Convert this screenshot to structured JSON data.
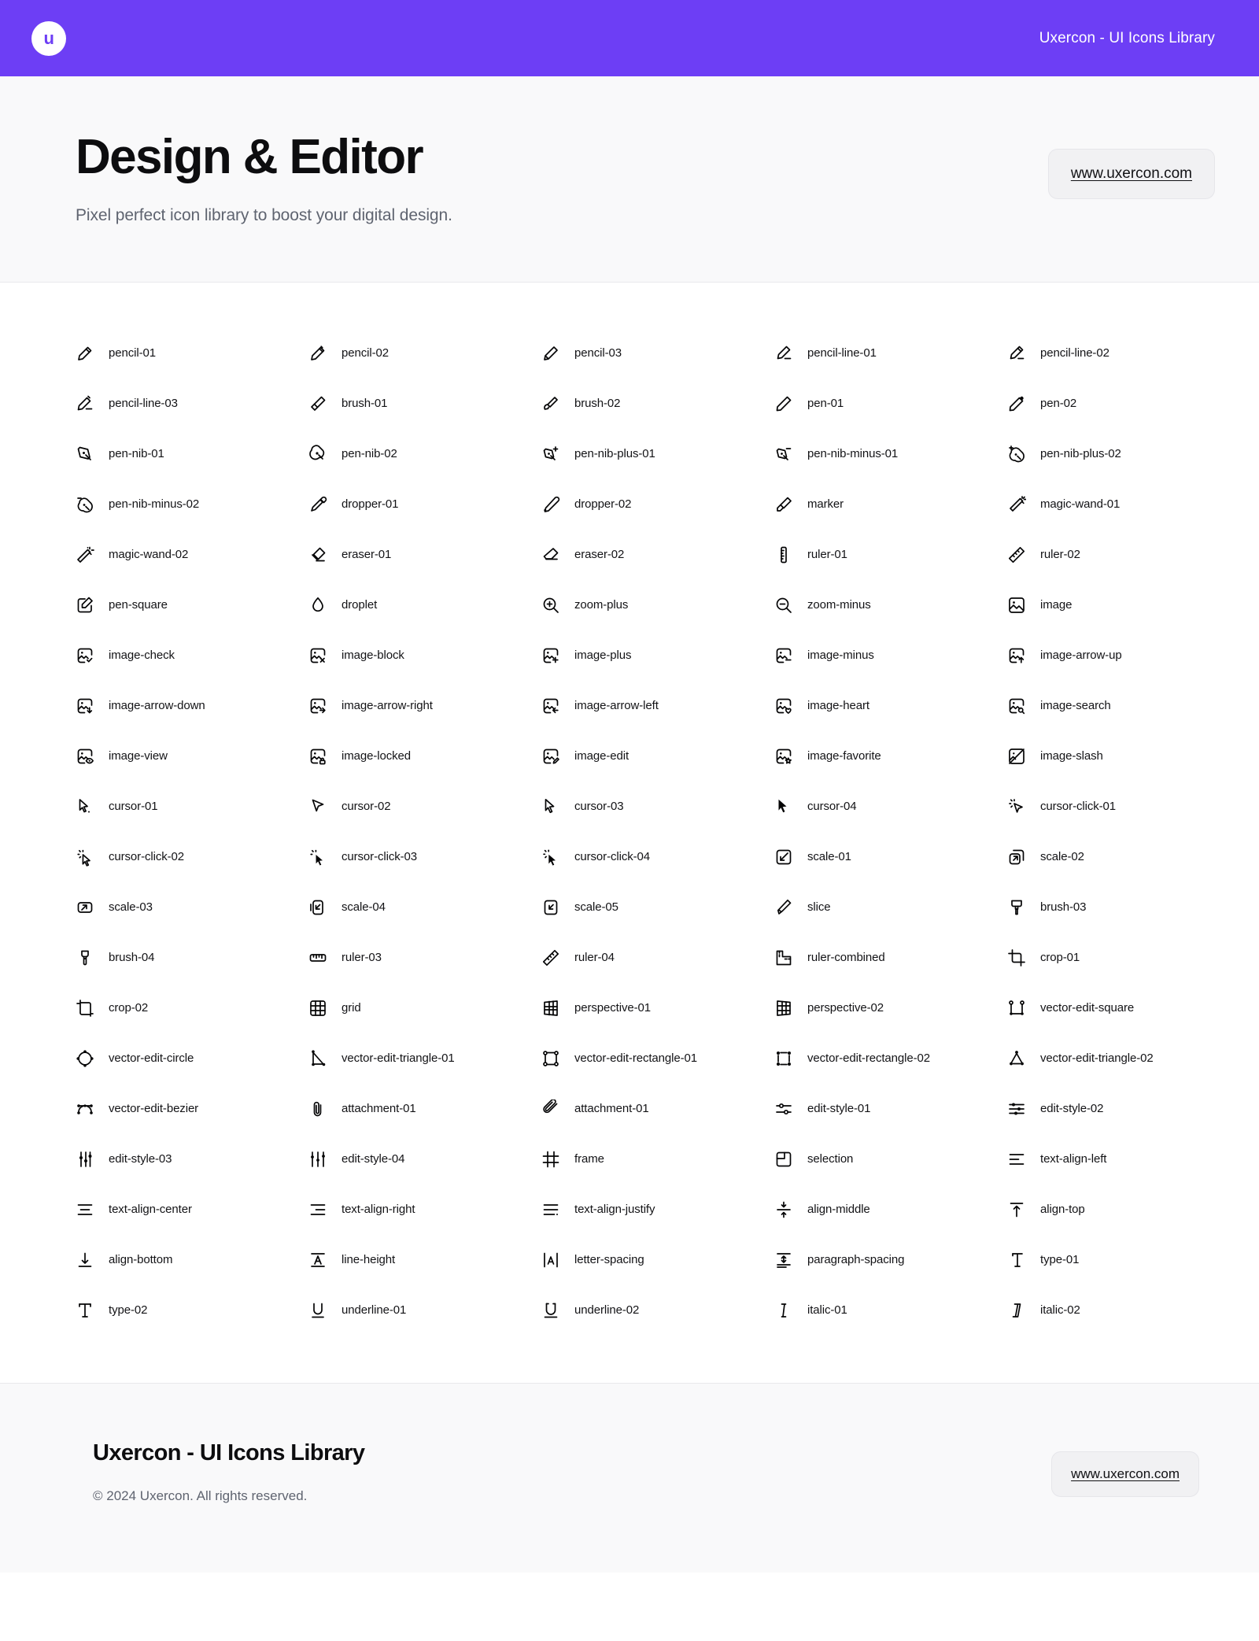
{
  "topbar": {
    "logo_glyph": "u",
    "logo_icon": "uxercon-logo-icon",
    "title": "Uxercon - UI Icons Library",
    "background_color": "#6d3ef5"
  },
  "hero": {
    "title": "Design & Editor",
    "subtitle": "Pixel perfect icon library to boost your digital design.",
    "url_label": "www.uxercon.com"
  },
  "grid": {
    "columns": 5,
    "rows": 20,
    "count": 100,
    "icons": [
      {
        "name": "pencil-01",
        "icon": "pencil-01-icon"
      },
      {
        "name": "pencil-02",
        "icon": "pencil-02-icon"
      },
      {
        "name": "pencil-03",
        "icon": "pencil-03-icon"
      },
      {
        "name": "pencil-line-01",
        "icon": "pencil-line-01-icon"
      },
      {
        "name": "pencil-line-02",
        "icon": "pencil-line-02-icon"
      },
      {
        "name": "pencil-line-03",
        "icon": "pencil-line-03-icon"
      },
      {
        "name": "brush-01",
        "icon": "brush-01-icon"
      },
      {
        "name": "brush-02",
        "icon": "brush-02-icon"
      },
      {
        "name": "pen-01",
        "icon": "pen-01-icon"
      },
      {
        "name": "pen-02",
        "icon": "pen-02-icon"
      },
      {
        "name": "pen-nib-01",
        "icon": "pen-nib-01-icon"
      },
      {
        "name": "pen-nib-02",
        "icon": "pen-nib-02-icon"
      },
      {
        "name": "pen-nib-plus-01",
        "icon": "pen-nib-plus-01-icon"
      },
      {
        "name": "pen-nib-minus-01",
        "icon": "pen-nib-minus-01-icon"
      },
      {
        "name": "pen-nib-plus-02",
        "icon": "pen-nib-plus-02-icon"
      },
      {
        "name": "pen-nib-minus-02",
        "icon": "pen-nib-minus-02-icon"
      },
      {
        "name": "dropper-01",
        "icon": "dropper-01-icon"
      },
      {
        "name": "dropper-02",
        "icon": "dropper-02-icon"
      },
      {
        "name": "marker",
        "icon": "marker-icon"
      },
      {
        "name": "magic-wand-01",
        "icon": "magic-wand-01-icon"
      },
      {
        "name": "magic-wand-02",
        "icon": "magic-wand-02-icon"
      },
      {
        "name": "eraser-01",
        "icon": "eraser-01-icon"
      },
      {
        "name": "eraser-02",
        "icon": "eraser-02-icon"
      },
      {
        "name": "ruler-01",
        "icon": "ruler-01-icon"
      },
      {
        "name": "ruler-02",
        "icon": "ruler-02-icon"
      },
      {
        "name": "pen-square",
        "icon": "pen-square-icon"
      },
      {
        "name": "droplet",
        "icon": "droplet-icon"
      },
      {
        "name": "zoom-plus",
        "icon": "zoom-plus-icon"
      },
      {
        "name": "zoom-minus",
        "icon": "zoom-minus-icon"
      },
      {
        "name": "image",
        "icon": "image-icon"
      },
      {
        "name": "image-check",
        "icon": "image-check-icon"
      },
      {
        "name": "image-block",
        "icon": "image-block-icon"
      },
      {
        "name": "image-plus",
        "icon": "image-plus-icon"
      },
      {
        "name": "image-minus",
        "icon": "image-minus-icon"
      },
      {
        "name": "image-arrow-up",
        "icon": "image-arrow-up-icon"
      },
      {
        "name": "image-arrow-down",
        "icon": "image-arrow-down-icon"
      },
      {
        "name": "image-arrow-right",
        "icon": "image-arrow-right-icon"
      },
      {
        "name": "image-arrow-left",
        "icon": "image-arrow-left-icon"
      },
      {
        "name": "image-heart",
        "icon": "image-heart-icon"
      },
      {
        "name": "image-search",
        "icon": "image-search-icon"
      },
      {
        "name": "image-view",
        "icon": "image-view-icon"
      },
      {
        "name": "image-locked",
        "icon": "image-locked-icon"
      },
      {
        "name": "image-edit",
        "icon": "image-edit-icon"
      },
      {
        "name": "image-favorite",
        "icon": "image-favorite-icon"
      },
      {
        "name": "image-slash",
        "icon": "image-slash-icon"
      },
      {
        "name": "cursor-01",
        "icon": "cursor-01-icon"
      },
      {
        "name": "cursor-02",
        "icon": "cursor-02-icon"
      },
      {
        "name": "cursor-03",
        "icon": "cursor-03-icon"
      },
      {
        "name": "cursor-04",
        "icon": "cursor-04-icon"
      },
      {
        "name": "cursor-click-01",
        "icon": "cursor-click-01-icon"
      },
      {
        "name": "cursor-click-02",
        "icon": "cursor-click-02-icon"
      },
      {
        "name": "cursor-click-03",
        "icon": "cursor-click-03-icon"
      },
      {
        "name": "cursor-click-04",
        "icon": "cursor-click-04-icon"
      },
      {
        "name": "scale-01",
        "icon": "scale-01-icon"
      },
      {
        "name": "scale-02",
        "icon": "scale-02-icon"
      },
      {
        "name": "scale-03",
        "icon": "scale-03-icon"
      },
      {
        "name": "scale-04",
        "icon": "scale-04-icon"
      },
      {
        "name": "scale-05",
        "icon": "scale-05-icon"
      },
      {
        "name": "slice",
        "icon": "slice-icon"
      },
      {
        "name": "brush-03",
        "icon": "brush-03-icon"
      },
      {
        "name": "brush-04",
        "icon": "brush-04-icon"
      },
      {
        "name": "ruler-03",
        "icon": "ruler-03-icon"
      },
      {
        "name": "ruler-04",
        "icon": "ruler-04-icon"
      },
      {
        "name": "ruler-combined",
        "icon": "ruler-combined-icon"
      },
      {
        "name": "crop-01",
        "icon": "crop-01-icon"
      },
      {
        "name": "crop-02",
        "icon": "crop-02-icon"
      },
      {
        "name": "grid",
        "icon": "grid-icon"
      },
      {
        "name": "perspective-01",
        "icon": "perspective-01-icon"
      },
      {
        "name": "perspective-02",
        "icon": "perspective-02-icon"
      },
      {
        "name": "vector-edit-square",
        "icon": "vector-edit-square-icon"
      },
      {
        "name": "vector-edit-circle",
        "icon": "vector-edit-circle-icon"
      },
      {
        "name": "vector-edit-triangle-01",
        "icon": "vector-edit-triangle-01-icon"
      },
      {
        "name": "vector-edit-rectangle-01",
        "icon": "vector-edit-rectangle-01-icon"
      },
      {
        "name": "vector-edit-rectangle-02",
        "icon": "vector-edit-rectangle-02-icon"
      },
      {
        "name": "vector-edit-triangle-02",
        "icon": "vector-edit-triangle-02-icon"
      },
      {
        "name": "vector-edit-bezier",
        "icon": "vector-edit-bezier-icon"
      },
      {
        "name": "attachment-01",
        "icon": "attachment-01-icon"
      },
      {
        "name": "attachment-01",
        "icon": "attachment-02-icon"
      },
      {
        "name": "edit-style-01",
        "icon": "edit-style-01-icon"
      },
      {
        "name": "edit-style-02",
        "icon": "edit-style-02-icon"
      },
      {
        "name": "edit-style-03",
        "icon": "edit-style-03-icon"
      },
      {
        "name": "edit-style-04",
        "icon": "edit-style-04-icon"
      },
      {
        "name": "frame",
        "icon": "frame-icon"
      },
      {
        "name": "selection",
        "icon": "selection-icon"
      },
      {
        "name": "text-align-left",
        "icon": "text-align-left-icon"
      },
      {
        "name": "text-align-center",
        "icon": "text-align-center-icon"
      },
      {
        "name": "text-align-right",
        "icon": "text-align-right-icon"
      },
      {
        "name": "text-align-justify",
        "icon": "text-align-justify-icon"
      },
      {
        "name": "align-middle",
        "icon": "align-middle-icon"
      },
      {
        "name": "align-top",
        "icon": "align-top-icon"
      },
      {
        "name": "align-bottom",
        "icon": "align-bottom-icon"
      },
      {
        "name": "line-height",
        "icon": "line-height-icon"
      },
      {
        "name": "letter-spacing",
        "icon": "letter-spacing-icon"
      },
      {
        "name": "paragraph-spacing",
        "icon": "paragraph-spacing-icon"
      },
      {
        "name": "type-01",
        "icon": "type-01-icon"
      },
      {
        "name": "type-02",
        "icon": "type-02-icon"
      },
      {
        "name": "underline-01",
        "icon": "underline-01-icon"
      },
      {
        "name": "underline-02",
        "icon": "underline-02-icon"
      },
      {
        "name": "italic-01",
        "icon": "italic-01-icon"
      },
      {
        "name": "italic-02",
        "icon": "italic-02-icon"
      }
    ]
  },
  "footer": {
    "title": "Uxercon - UI Icons Library",
    "copyright": "© 2024 Uxercon. All rights reserved.",
    "url_label": "www.uxercon.com"
  }
}
